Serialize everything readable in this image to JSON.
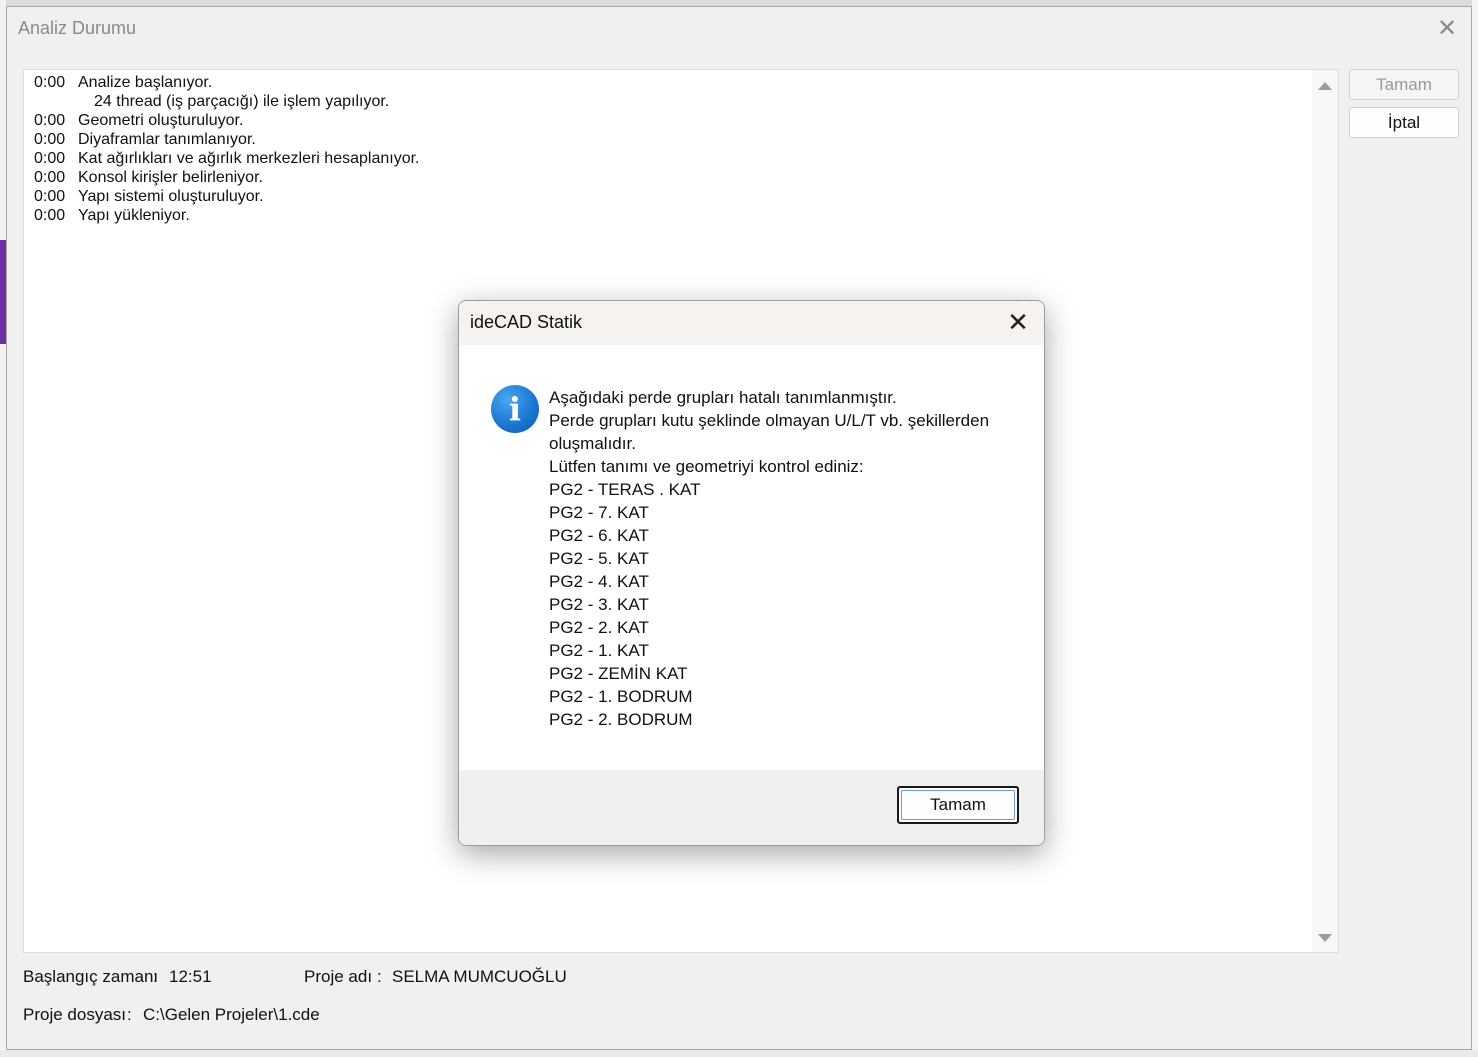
{
  "main_window": {
    "title": "Analiz Durumu",
    "close_glyph": "✕",
    "log": [
      {
        "time": "0:00",
        "message": "Analize başlanıyor."
      },
      {
        "time": "",
        "message": "24 thread (iş parçacığı) ile işlem yapılıyor."
      },
      {
        "time": "0:00",
        "message": "Geometri oluşturuluyor."
      },
      {
        "time": "0:00",
        "message": "Diyaframlar tanımlanıyor."
      },
      {
        "time": "0:00",
        "message": "Kat ağırlıkları ve ağırlık merkezleri hesaplanıyor."
      },
      {
        "time": "0:00",
        "message": "Konsol kirişler belirleniyor."
      },
      {
        "time": "0:00",
        "message": "Yapı sistemi oluşturuluyor."
      },
      {
        "time": "0:00",
        "message": "Yapı yükleniyor."
      }
    ],
    "buttons": {
      "ok_label": "Tamam",
      "cancel_label": "İptal"
    },
    "footer": {
      "start_time_label": "Başlangıç zamanı",
      "start_time_value": "12:51",
      "project_name_label": "Proje adı",
      "project_name_value": "SELMA MUMCUOĞLU",
      "project_file_label": "Proje dosyası",
      "project_file_value": "C:\\Gelen Projeler\\1.cde",
      "separator": ":"
    }
  },
  "dialog": {
    "title": "ideCAD Statik",
    "close_glyph": "✕",
    "icon": "info-icon",
    "icon_glyph": "i",
    "message_lines": [
      "Aşağıdaki perde grupları hatalı tanımlanmıştır.",
      "Perde grupları kutu şeklinde olmayan U/L/T vb. şekillerden",
      "oluşmalıdır.",
      "Lütfen tanımı ve geometriyi kontrol ediniz:",
      "PG2 - TERAS . KAT",
      "PG2 - 7. KAT",
      "PG2 - 6. KAT",
      "PG2 - 5. KAT",
      "PG2 - 4. KAT",
      "PG2 - 3. KAT",
      "PG2 - 2. KAT",
      "PG2 - 1. KAT",
      "PG2 - ZEMİN KAT",
      "PG2 - 1. BODRUM",
      "PG2 - 2. BODRUM"
    ],
    "ok_label": "Tamam"
  },
  "colors": {
    "info_icon_blue": "#1b77d2",
    "dialog_titlebar": "#f5f2ef",
    "focus_outline": "#6b9bd6"
  }
}
